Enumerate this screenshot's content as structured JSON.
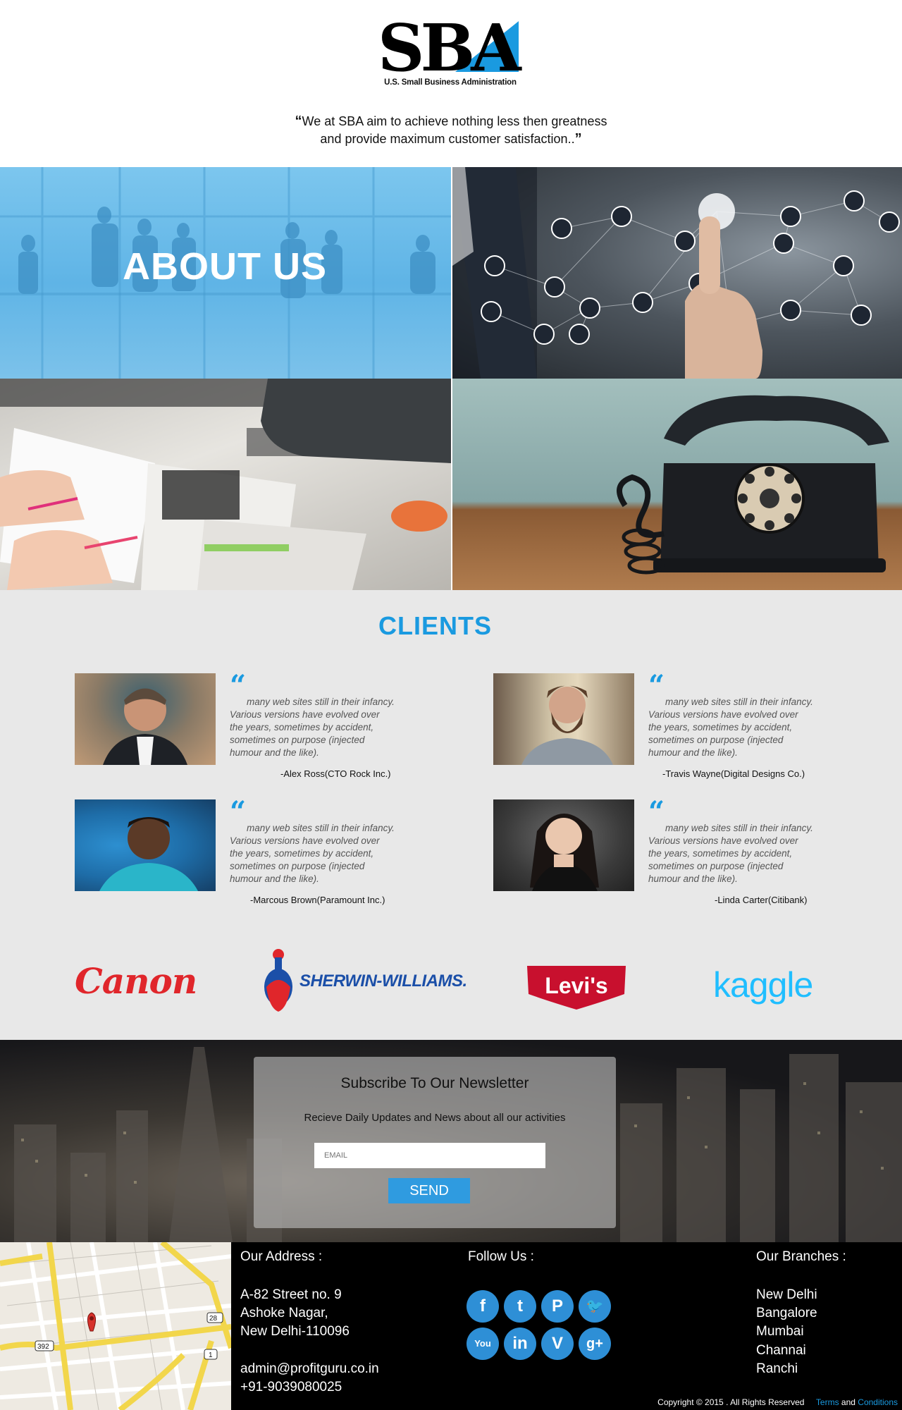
{
  "header": {
    "logo_sub": "U.S. Small Business Administration",
    "tagline_line1": "We at SBA aim to achieve nothing less then greatness",
    "tagline_line2": "and provide maximum customer satisfaction..",
    "open_quote": "“",
    "close_quote": "”"
  },
  "hero": {
    "about_title": "ABOUT US"
  },
  "clients": {
    "title": "CLIENTS",
    "quote_glyph": "“",
    "testimonials": [
      {
        "text": "many web sites still in their infancy. Various versions have evolved over the years, sometimes by accident, sometimes on purpose (injected humour and the like).",
        "author": "-Alex Ross(CTO Rock Inc.)"
      },
      {
        "text": "many web sites still in their infancy. Various versions have evolved over the years, sometimes by accident, sometimes on purpose (injected humour and the like).",
        "author": "-Travis Wayne(Digital Designs Co.)"
      },
      {
        "text": "many web sites still in their infancy. Various versions have evolved over the years, sometimes by accident, sometimes on purpose (injected humour and the like).",
        "author": "-Marcous Brown(Paramount Inc.)"
      },
      {
        "text": "many web sites still in their infancy. Various versions have evolved over the years, sometimes by accident, sometimes on purpose (injected humour and the like).",
        "author": "-Linda Carter(Citibank)"
      }
    ],
    "brands": [
      "Canon",
      "SHERWIN-WILLIAMS.",
      "Levi's",
      "kaggle"
    ]
  },
  "newsletter": {
    "title": "Subscribe To Our Newsletter",
    "subtitle": "Recieve Daily Updates and News about all our activities",
    "email_placeholder": "EMAIL",
    "send_label": "SEND"
  },
  "footer": {
    "address_heading": "Our Address :",
    "address_lines": [
      "A-82 Street no. 9",
      "Ashoke Nagar,",
      "New Delhi-110096"
    ],
    "email": "admin@profitguru.co.in",
    "phone": "+91-9039080025",
    "follow_heading": "Follow Us :",
    "social_icons": [
      "facebook-icon",
      "tumblr-icon",
      "pinterest-icon",
      "twitter-icon",
      "youtube-icon",
      "linkedin-icon",
      "vimeo-icon",
      "google-plus-icon"
    ],
    "social_glyphs": [
      "f",
      "t",
      "P",
      "🐦",
      "You",
      "in",
      "V",
      "g+"
    ],
    "branches_heading": "Our Branches :",
    "branches": [
      "New Delhi",
      "Bangalore",
      "Mumbai",
      "Channai",
      "Ranchi"
    ],
    "copyright": "Copyright © 2015 . All Rights Reserved",
    "terms": "Terms",
    "and_text": "and",
    "conditions": "Conditions"
  },
  "map": {
    "labels": [
      "392",
      "28",
      "1"
    ]
  },
  "colors": {
    "accent": "#1a9ae0",
    "social": "#2e8fd6",
    "footer_bg": "#000000",
    "clients_bg": "#e8e8e8"
  }
}
